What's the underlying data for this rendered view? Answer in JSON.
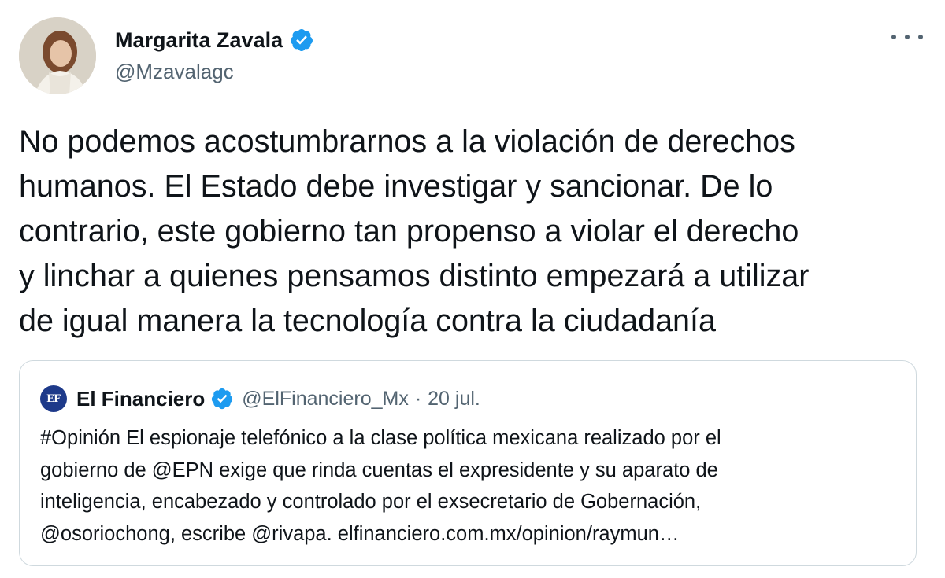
{
  "author": {
    "name": "Margarita Zavala",
    "handle": "@Mzavalagc",
    "avatar_icon": "avatar-photo-icon",
    "verified_icon": "verified-badge-icon"
  },
  "menu": {
    "more_icon": "more-options-icon"
  },
  "tweet": {
    "text": "No podemos acostumbrarnos a la violación de derechos\nhumanos. El Estado debe investigar y sancionar. De lo\ncontrario, este gobierno tan propenso a violar el derecho\ny linchar a quienes pensamos distinto empezará a utilizar\nde igual manera la tecnología contra la ciudadanía"
  },
  "quote": {
    "logo_text": "EF",
    "name": "El Financiero",
    "handle": "@ElFinanciero_Mx",
    "separator": "·",
    "date": "20 jul.",
    "text": "#Opinión El espionaje telefónico a la clase política mexicana realizado por el\ngobierno de @EPN exige que rinda cuentas el expresidente y su aparato de\ninteligencia, encabezado y controlado por el exsecretario de Gobernación,\n@osoriochong, escribe @rivapa. elfinanciero.com.mx/opinion/raymun…"
  },
  "colors": {
    "verified_blue": "#1d9bf0",
    "text_primary": "#0f1419",
    "text_secondary": "#536471",
    "border": "#cfd9de",
    "ef_logo_bg": "#1e3a8a"
  }
}
